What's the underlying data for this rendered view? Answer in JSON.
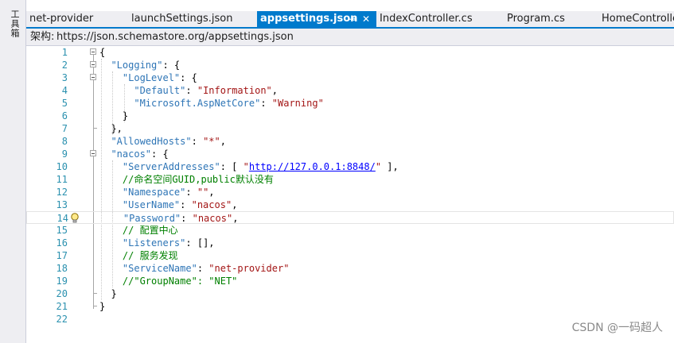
{
  "toolbox": {
    "label": "工具箱"
  },
  "tabs": [
    {
      "label": "net-provider",
      "active": false
    },
    {
      "label": "launchSettings.json",
      "active": false
    },
    {
      "label": "appsettings.json",
      "active": true,
      "pin_icon": "pin-icon",
      "close_icon": "close-icon"
    },
    {
      "label": "IndexController.cs",
      "active": false
    },
    {
      "label": "Program.cs",
      "active": false
    },
    {
      "label": "HomeController",
      "active": false
    }
  ],
  "schema_bar": {
    "label": "架构:",
    "url": "https://json.schemastore.org/appsettings.json"
  },
  "editor": {
    "current_line": 14,
    "lightbulb_line": 14,
    "line_numbers": [
      "1",
      "2",
      "3",
      "4",
      "5",
      "6",
      "7",
      "8",
      "9",
      "10",
      "11",
      "12",
      "13",
      "14",
      "15",
      "16",
      "17",
      "18",
      "19",
      "20",
      "21",
      "22"
    ],
    "lines": [
      [
        [
          "p",
          "{"
        ]
      ],
      [
        [
          "p",
          "  "
        ],
        [
          "k",
          "\"Logging\""
        ],
        [
          "p",
          ": {"
        ]
      ],
      [
        [
          "p",
          "    "
        ],
        [
          "k",
          "\"LogLevel\""
        ],
        [
          "p",
          ": {"
        ]
      ],
      [
        [
          "p",
          "      "
        ],
        [
          "k",
          "\"Default\""
        ],
        [
          "p",
          ": "
        ],
        [
          "s",
          "\"Information\""
        ],
        [
          "p",
          ","
        ]
      ],
      [
        [
          "p",
          "      "
        ],
        [
          "k",
          "\"Microsoft.AspNetCore\""
        ],
        [
          "p",
          ": "
        ],
        [
          "s",
          "\"Warning\""
        ]
      ],
      [
        [
          "p",
          "    }"
        ]
      ],
      [
        [
          "p",
          "  },"
        ]
      ],
      [
        [
          "p",
          "  "
        ],
        [
          "k",
          "\"AllowedHosts\""
        ],
        [
          "p",
          ": "
        ],
        [
          "s",
          "\"*\""
        ],
        [
          "p",
          ","
        ]
      ],
      [
        [
          "p",
          "  "
        ],
        [
          "k",
          "\"nacos\""
        ],
        [
          "p",
          ": {"
        ]
      ],
      [
        [
          "p",
          "    "
        ],
        [
          "k",
          "\"ServerAddresses\""
        ],
        [
          "p",
          ": [ "
        ],
        [
          "s",
          "\""
        ],
        [
          "u",
          "http://127.0.0.1:8848/"
        ],
        [
          "s",
          "\""
        ],
        [
          "p",
          " ],"
        ]
      ],
      [
        [
          "p",
          "    "
        ],
        [
          "c",
          "//命名空间GUID,public默认没有"
        ]
      ],
      [
        [
          "p",
          "    "
        ],
        [
          "k",
          "\"Namespace\""
        ],
        [
          "p",
          ": "
        ],
        [
          "s",
          "\"\""
        ],
        [
          "p",
          ","
        ]
      ],
      [
        [
          "p",
          "    "
        ],
        [
          "k",
          "\"UserName\""
        ],
        [
          "p",
          ": "
        ],
        [
          "s",
          "\"nacos\""
        ],
        [
          "p",
          ","
        ]
      ],
      [
        [
          "p",
          "    "
        ],
        [
          "k",
          "\"Password\""
        ],
        [
          "p",
          ": "
        ],
        [
          "s",
          "\"nacos\""
        ],
        [
          "p",
          ","
        ]
      ],
      [
        [
          "p",
          "    "
        ],
        [
          "c",
          "// 配置中心"
        ]
      ],
      [
        [
          "p",
          "    "
        ],
        [
          "k",
          "\"Listeners\""
        ],
        [
          "p",
          ": [],"
        ]
      ],
      [
        [
          "p",
          "    "
        ],
        [
          "c",
          "// 服务发现"
        ]
      ],
      [
        [
          "p",
          "    "
        ],
        [
          "k",
          "\"ServiceName\""
        ],
        [
          "p",
          ": "
        ],
        [
          "s",
          "\"net-provider\""
        ]
      ],
      [
        [
          "p",
          "    "
        ],
        [
          "c",
          "//\"GroupName\": \"NET\""
        ]
      ],
      [
        [
          "p",
          "  }"
        ]
      ],
      [
        [
          "p",
          "}"
        ]
      ],
      [
        [
          "p",
          ""
        ]
      ]
    ]
  },
  "watermark": "CSDN @一码超人",
  "colors": {
    "accent": "#007acc",
    "key": "#2e75b6",
    "string": "#a31515",
    "comment": "#008000",
    "line_number": "#2b91af"
  }
}
